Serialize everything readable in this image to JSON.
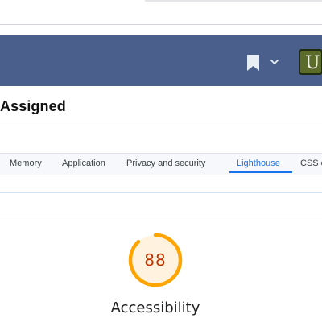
{
  "app_header": {
    "bookmark_icon": "bookmark-icon",
    "dropdown_icon": "chevron-down-icon",
    "avatar_letter": "U",
    "header_color": "#4a5f8c",
    "avatar_color": "#5b6b2a"
  },
  "issue": {
    "title": "Assigned"
  },
  "devtools": {
    "tabs": [
      {
        "label": "Memory"
      },
      {
        "label": "Application"
      },
      {
        "label": "Privacy and security"
      },
      {
        "label": "Lighthouse",
        "active": true
      },
      {
        "label": "CSS o"
      }
    ],
    "accent_color": "#1a73e8"
  },
  "lighthouse": {
    "score": "88",
    "score_value": 0.88,
    "category": "Accessibility",
    "gauge_color": "#ffa400",
    "gauge_fill": "#fff3e0"
  }
}
